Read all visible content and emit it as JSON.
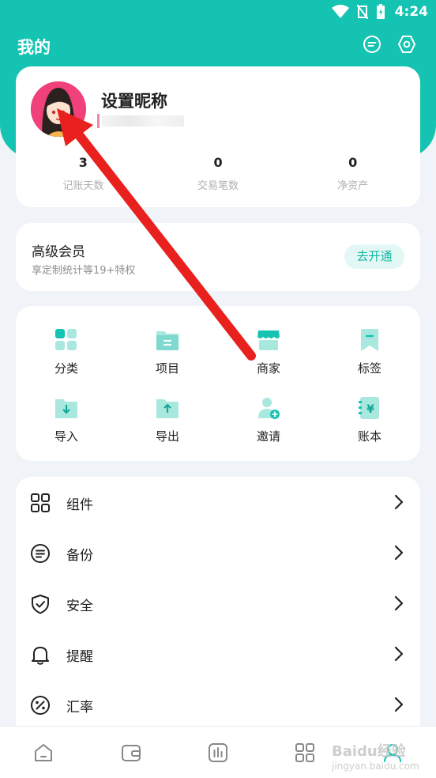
{
  "status_bar": {
    "time": "4:24"
  },
  "header": {
    "title": "我的",
    "icons": [
      "message-icon",
      "settings-icon"
    ]
  },
  "profile": {
    "nickname": "设置昵称",
    "stats": [
      {
        "value": "3",
        "label": "记账天数"
      },
      {
        "value": "0",
        "label": "交易笔数"
      },
      {
        "value": "0",
        "label": "净资产"
      }
    ]
  },
  "vip": {
    "title": "高级会员",
    "subtitle": "享定制统计等19+特权",
    "button": "去开通"
  },
  "features": [
    {
      "label": "分类",
      "icon": "category-icon"
    },
    {
      "label": "项目",
      "icon": "project-folder-icon"
    },
    {
      "label": "商家",
      "icon": "merchant-store-icon"
    },
    {
      "label": "标签",
      "icon": "tag-bookmark-icon"
    },
    {
      "label": "导入",
      "icon": "import-icon"
    },
    {
      "label": "导出",
      "icon": "export-icon"
    },
    {
      "label": "邀请",
      "icon": "invite-user-icon"
    },
    {
      "label": "账本",
      "icon": "ledger-icon"
    }
  ],
  "menu": [
    {
      "label": "组件",
      "icon": "widget-grid-icon"
    },
    {
      "label": "备份",
      "icon": "backup-icon"
    },
    {
      "label": "安全",
      "icon": "shield-icon"
    },
    {
      "label": "提醒",
      "icon": "bell-icon"
    },
    {
      "label": "汇率",
      "icon": "percent-icon"
    }
  ],
  "bottom_nav": [
    "home-icon",
    "wallet-icon",
    "stats-chart-icon",
    "apps-icon",
    "profile-icon"
  ],
  "watermark": {
    "brand": "Baidu",
    "suffix": "经验",
    "url": "jingyan.baidu.com"
  },
  "colors": {
    "accent": "#14c3b1",
    "annotation_arrow": "#e8201e"
  }
}
